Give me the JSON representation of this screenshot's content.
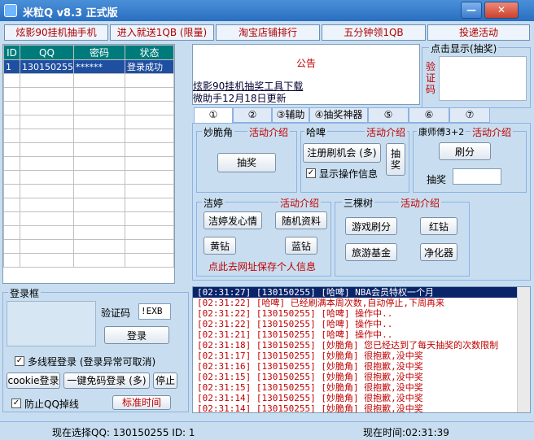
{
  "window": {
    "title": "米粒Q v8.3 正式版",
    "minimize": "—",
    "close": "✕"
  },
  "topnav": [
    "炫影90挂机抽手机",
    "进入就送1QB (限量)",
    "淘宝店铺排行",
    "五分钟领1QB",
    "投递活动"
  ],
  "grid": {
    "headers": [
      "ID",
      "QQ",
      "密码",
      "状态"
    ],
    "rows": [
      [
        "1",
        "130150255",
        "******",
        "登录成功"
      ]
    ]
  },
  "notice": {
    "title": "公告",
    "line1": "炫影90挂机抽奖工具下载",
    "line2": "微助手12月18日更新"
  },
  "captcha_display": {
    "legend": "点击显示(抽奖)",
    "label": "验证码"
  },
  "tabs": [
    "①",
    "②",
    "③辅助",
    "④抽奖神器",
    "⑤",
    "⑥",
    "⑦"
  ],
  "groups": {
    "miaocuijiao": {
      "title": "妙脆角",
      "link": "活动介绍",
      "button": "抽奖"
    },
    "haha": {
      "title": "哈啤",
      "link": "活动介绍",
      "register_button": "注册刷机会 (多)",
      "draw_button": "抽奖",
      "checkbox_label": "显示操作信息"
    },
    "kangshifu": {
      "title": "康师傅3+2",
      "link": "活动介绍",
      "brush_button": "刷分",
      "draw_label": "抽奖",
      "draw_value": ""
    },
    "jieting": {
      "title": "洁婷",
      "link": "活动介绍",
      "btn1": "洁婷发心情",
      "btn2": "随机资料",
      "btn3": "黄钻",
      "btn4": "蓝钻",
      "save_link": "点此去网址保存个人信息"
    },
    "sankeshu": {
      "title": "三棵树",
      "link": "活动介绍",
      "btn1": "游戏刷分",
      "btn2": "红钻",
      "btn3": "旅游基金",
      "btn4": "净化器"
    }
  },
  "login": {
    "legend": "登录框",
    "captcha_label": "验证码",
    "captcha_value": "!EXB",
    "login_button": "登录",
    "multi_thread_label": "多线程登录 (登录异常可取消)",
    "cookie_button": "cookie登录",
    "one_key_button": "一键免码登录 (多)",
    "stop_button": "停止",
    "drop_label": "防止QQ掉线",
    "std_time_button": "标准时间"
  },
  "log": [
    "[02:31:27] [130150255] [哈啤] NBA会员特权一个月",
    "[02:31:22] [哈啤] 已经刷满本周次数,自动停止,下周再来",
    "[02:31:22] [130150255] [哈啤] 操作中..",
    "[02:31:22] [130150255] [哈啤] 操作中..",
    "[02:31:21] [130150255] [哈啤] 操作中..",
    "[02:31:18] [130150255] [妙脆角] 您已经达到了每天抽奖的次数限制",
    "[02:31:17] [130150255] [妙脆角] 很抱歉,没中奖",
    "[02:31:16] [130150255] [妙脆角] 很抱歉,没中奖",
    "[02:31:15] [130150255] [妙脆角] 很抱歉,没中奖",
    "[02:31:15] [130150255] [妙脆角] 很抱歉,没中奖",
    "[02:31:14] [130150255] [妙脆角] 很抱歉,没中奖",
    "[02:31:14] [130150255] [妙脆角] 很抱歉,没中奖"
  ],
  "status": {
    "current": "现在选择QQ: 130150255  ID: 1",
    "time": "现在时间:02:31:39"
  }
}
